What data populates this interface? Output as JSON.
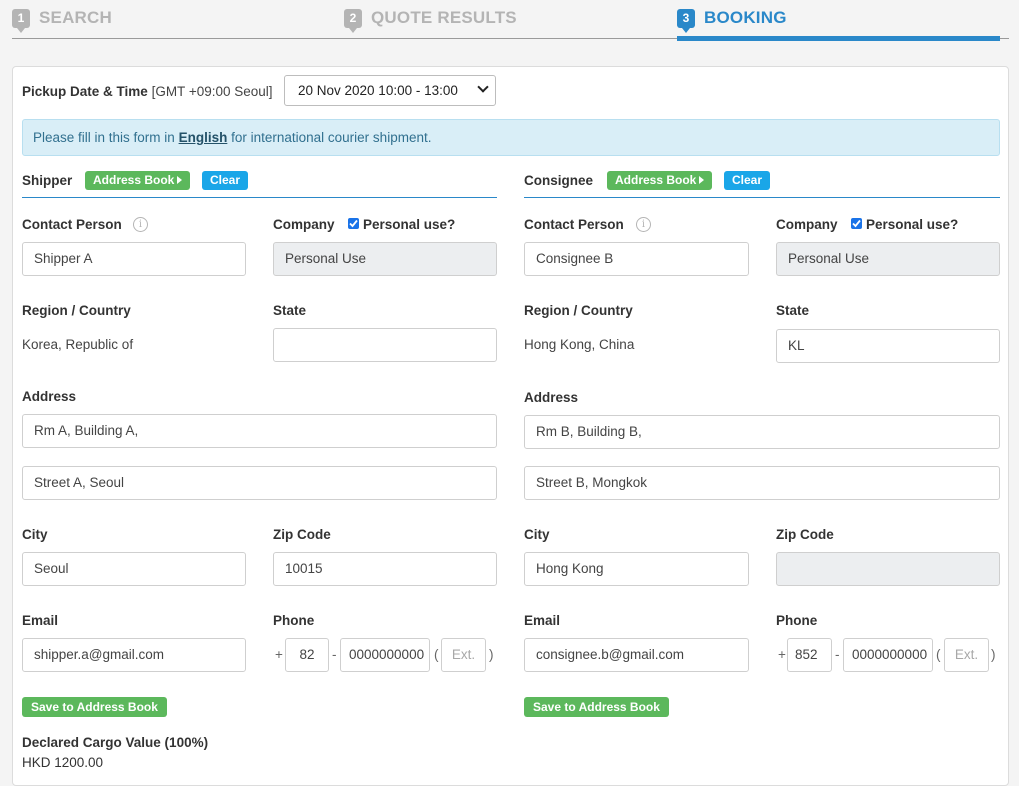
{
  "steps": [
    {
      "number": "1",
      "label": "SEARCH"
    },
    {
      "number": "2",
      "label": "QUOTE RESULTS"
    },
    {
      "number": "3",
      "label": "BOOKING"
    }
  ],
  "pickup": {
    "label": "Pickup Date & Time",
    "timezone": "[GMT +09:00 Seoul]",
    "selected": "20 Nov 2020 10:00 - 13:00"
  },
  "notice": {
    "prefix": "Please fill in this form in",
    "highlight": "English",
    "suffix": "for international courier shipment."
  },
  "common": {
    "address_book": "Address Book",
    "clear": "Clear",
    "save_to_address_book": "Save to Address Book",
    "contact_person_label": "Contact Person",
    "company_label": "Company",
    "personal_use_label": "Personal use?",
    "region_label": "Region / Country",
    "state_label": "State",
    "address_label": "Address",
    "city_label": "City",
    "zip_label": "Zip Code",
    "email_label": "Email",
    "phone_label": "Phone",
    "plus": "+",
    "dash": "-",
    "paren_open": "(",
    "paren_close": ")",
    "ext_placeholder": "Ext."
  },
  "shipper": {
    "title": "Shipper",
    "contact_person": "Shipper A",
    "company": "Personal Use",
    "personal_use": true,
    "region": "Korea, Republic of",
    "state": "",
    "address1": "Rm A, Building A,",
    "address2": "Street A, Seoul",
    "city": "Seoul",
    "zip": "10015",
    "email": "shipper.a@gmail.com",
    "phone_country": "82",
    "phone_number": "0000000000"
  },
  "consignee": {
    "title": "Consignee",
    "contact_person": "Consignee B",
    "company": "Personal Use",
    "personal_use": true,
    "region": "Hong Kong, China",
    "state": "KL",
    "address1": "Rm B, Building B,",
    "address2": "Street B, Mongkok",
    "city": "Hong Kong",
    "zip": "",
    "email": "consignee.b@gmail.com",
    "phone_country": "852",
    "phone_number": "0000000000"
  },
  "declared": {
    "label": "Declared Cargo Value (100%)",
    "value": "HKD 1200.00"
  },
  "colors": {
    "accent": "#2a88c9",
    "inactive_step": "#b4b4b4",
    "green_button": "#5cb85c",
    "blue_button": "#1aa6e8",
    "notice_bg": "#d9eef7"
  }
}
